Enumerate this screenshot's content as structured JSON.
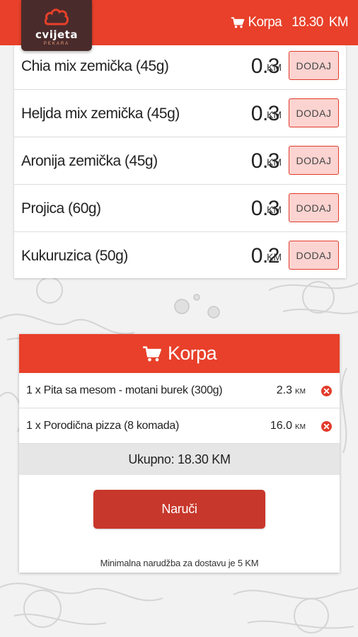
{
  "header": {
    "logo_text": "cvijeta",
    "logo_sub": "PEKARA",
    "cart_label": "Korpa",
    "cart_total": "18.30",
    "cart_currency": "KM"
  },
  "products": [
    {
      "name": "Chia mix zemička (45g)",
      "price": "0.3",
      "currency": "KM",
      "button": "DODAJ"
    },
    {
      "name": "Heljda mix zemička (45g)",
      "price": "0.3",
      "currency": "KM",
      "button": "DODAJ"
    },
    {
      "name": "Aronija zemička (45g)",
      "price": "0.3",
      "currency": "KM",
      "button": "DODAJ"
    },
    {
      "name": "Projica (60g)",
      "price": "0.3",
      "currency": "KM",
      "button": "DODAJ"
    },
    {
      "name": "Kukuruzica (50g)",
      "price": "0.2",
      "currency": "KM",
      "button": "DODAJ"
    }
  ],
  "cart": {
    "title": "Korpa",
    "items": [
      {
        "desc": "1 x Pita sa mesom - motani burek (300g)",
        "price": "2.3",
        "currency": "KM"
      },
      {
        "desc": "1 x Porodična pizza (8 komada)",
        "price": "16.0",
        "currency": "KM"
      }
    ],
    "total_text": "Ukupno: 18.30 KM",
    "order_button": "Naruči",
    "min_note": "Minimalna narudžba za dostavu je 5 KM"
  },
  "colors": {
    "accent": "#e8402a",
    "button_dark": "#c8372b",
    "logo_bg": "#4a2b2b",
    "add_bg": "#fbd3d0"
  },
  "icons": [
    "cart-icon",
    "remove-icon",
    "cloud-logo-icon"
  ]
}
